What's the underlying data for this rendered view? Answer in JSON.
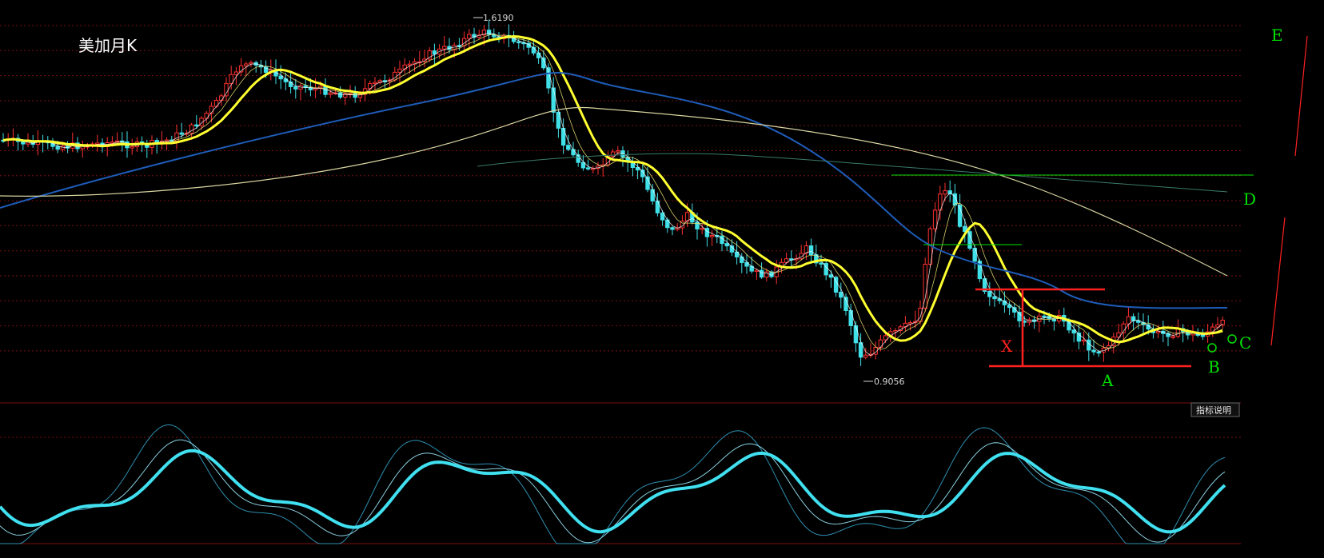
{
  "chart_data": {
    "type": "candlestick",
    "title": "美加月K",
    "price_labels": {
      "high": "1.6190",
      "low": "0.9056"
    },
    "annotations": {
      "E": "E",
      "D": "D",
      "C": "C",
      "B": "B",
      "A": "A",
      "X": "X"
    },
    "indicator_button": "指标说明",
    "colors": {
      "background": "#000000",
      "grid": "#7a0f0f",
      "up_candle": "#ff3030",
      "down_candle": "#40e0e8",
      "ma_short": "#ffffff",
      "ma_mid": "#ffff30",
      "ma_long": "#1e5cb8",
      "ma_longest": "#d8d4a0",
      "annotation_green": "#00e000",
      "annotation_red": "#ff2020",
      "oscillator": "#40e0f0"
    }
  }
}
